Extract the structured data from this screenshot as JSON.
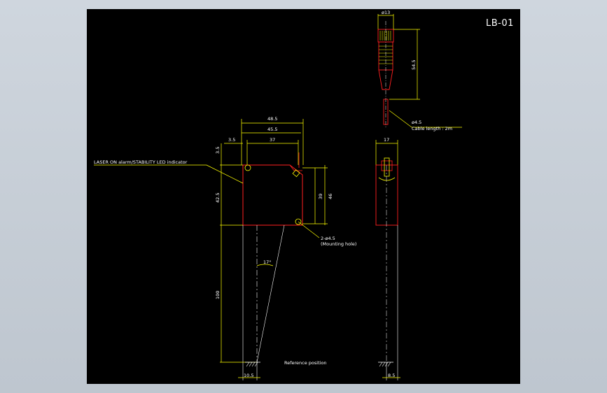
{
  "drawing": {
    "title": "LB-01",
    "colors": {
      "background": "#000000",
      "frame": "#c9d0d8",
      "outline": "#ff2020",
      "dimension": "#ffff00",
      "text": "#ffffff",
      "center_line": "#ffff00"
    },
    "front_view": {
      "dims": {
        "width_total": "48.5",
        "width_inner": "45.5",
        "hole_spacing": "37",
        "offset_left": "3.5",
        "offset_top": "3.5",
        "height_left": "42.5",
        "height_hole": "39",
        "height_total": "46",
        "range": "100",
        "angle": "17°",
        "bottom_offset": "10.5"
      },
      "notes": {
        "led_indicator": "LASER ON alarm/STABILITY LED indicator",
        "mounting_hole": "2-ø4.5",
        "mounting_hole_label": "(Mounting hole)",
        "reference_position": "Reference position"
      }
    },
    "cable_view": {
      "dims": {
        "diameter": "ø13",
        "length": "54.5",
        "cable_diameter": "ø4.5"
      },
      "notes": {
        "cable_length": "Cable length : 2m"
      }
    },
    "side_view": {
      "dims": {
        "width": "17",
        "bottom_offset": "8.5"
      }
    }
  }
}
